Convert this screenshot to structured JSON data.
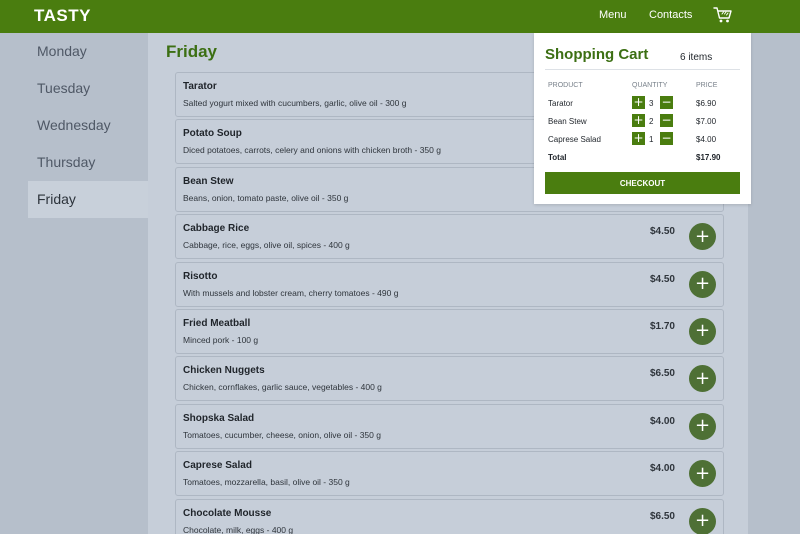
{
  "header": {
    "logo": "TASTY",
    "nav": {
      "menu": "Menu",
      "contacts": "Contacts"
    },
    "cart_icon": "cart-icon",
    "accent": "#4a7d0f"
  },
  "sidebar": {
    "days": [
      {
        "label": "Monday",
        "active": false
      },
      {
        "label": "Tuesday",
        "active": false
      },
      {
        "label": "Wednesday",
        "active": false
      },
      {
        "label": "Thursday",
        "active": false
      },
      {
        "label": "Friday",
        "active": true
      }
    ]
  },
  "main": {
    "title": "Friday",
    "add_icon": "plus-icon",
    "items": [
      {
        "name": "Tarator",
        "desc": "Salted yogurt mixed with cucumbers, garlic, olive oil - 300 g",
        "price": ""
      },
      {
        "name": "Potato Soup",
        "desc": "Diced potatoes, carrots, celery and onions with chicken broth - 350 g",
        "price": ""
      },
      {
        "name": "Bean Stew",
        "desc": "Beans, onion, tomato paste, olive oil - 350 g",
        "price": ""
      },
      {
        "name": "Cabbage Rice",
        "desc": "Cabbage, rice, eggs, olive oil, spices - 400 g",
        "price": "$4.50"
      },
      {
        "name": "Risotto",
        "desc": "With mussels and lobster cream, cherry tomatoes - 490 g",
        "price": "$4.50"
      },
      {
        "name": "Fried Meatball",
        "desc": "Minced pork - 100 g",
        "price": "$1.70"
      },
      {
        "name": "Chicken Nuggets",
        "desc": "Chicken, cornflakes, garlic sauce, vegetables - 400 g",
        "price": "$6.50"
      },
      {
        "name": "Shopska Salad",
        "desc": "Tomatoes, cucumber, cheese, onion, olive oil - 350 g",
        "price": "$4.00"
      },
      {
        "name": "Caprese Salad",
        "desc": "Tomatoes, mozzarella, basil, olive oil - 350 g",
        "price": "$4.00"
      },
      {
        "name": "Chocolate Mousse",
        "desc": "Chocolate, milk, eggs - 400 g",
        "price": "$6.50"
      }
    ]
  },
  "cart": {
    "title": "Shopping Cart",
    "count": "6 items",
    "headers": {
      "product": "PRODUCT",
      "quantity": "QUANTITY",
      "price": "PRICE"
    },
    "rows": [
      {
        "product": "Tarator",
        "qty": "3",
        "price": "$6.90"
      },
      {
        "product": "Bean Stew",
        "qty": "2",
        "price": "$7.00"
      },
      {
        "product": "Caprese Salad",
        "qty": "1",
        "price": "$4.00"
      }
    ],
    "total_label": "Total",
    "total_value": "$17.90",
    "checkout": "CHECKOUT"
  }
}
